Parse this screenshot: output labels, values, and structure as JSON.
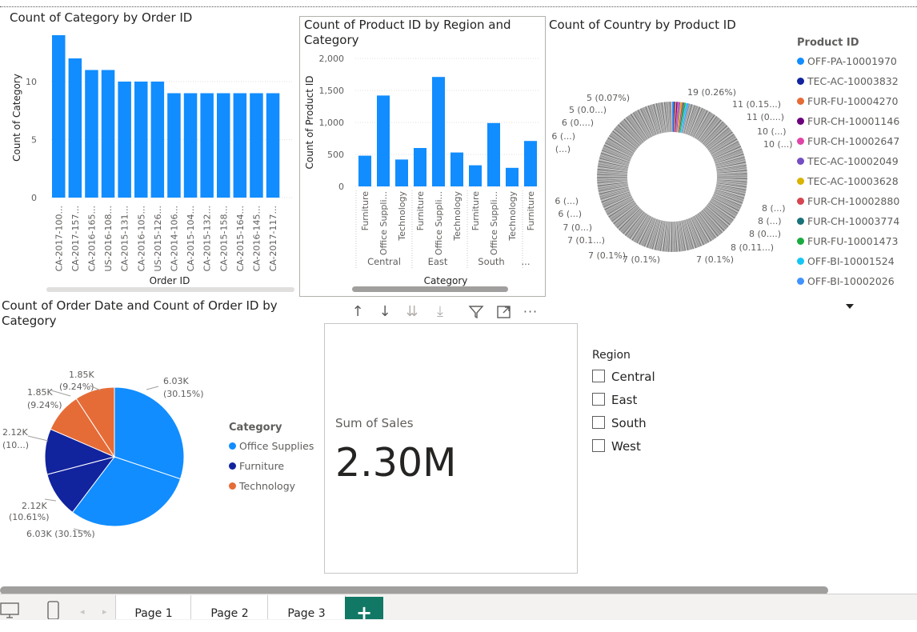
{
  "colors": {
    "accent": "#118dff",
    "navy": "#12239e",
    "orange": "#e66c37",
    "add_tab": "#117865"
  },
  "chart1": {
    "title": "Count of Category by Order ID",
    "chart_data": {
      "type": "bar",
      "title": "Count of Category by Order ID",
      "xlabel": "Order ID",
      "ylabel": "Count of Category",
      "ylim": [
        0,
        14
      ],
      "yticks": [
        "0",
        "5",
        "10"
      ],
      "categories": [
        "CA-2017-100...",
        "CA-2017-157...",
        "CA-2016-165...",
        "US-2016-108...",
        "CA-2015-131...",
        "CA-2016-105...",
        "US-2015-126...",
        "CA-2014-106...",
        "CA-2015-104...",
        "CA-2015-132...",
        "CA-2015-158...",
        "CA-2015-164...",
        "CA-2016-145...",
        "CA-2017-117..."
      ],
      "values": [
        14,
        12,
        11,
        11,
        10,
        10,
        10,
        9,
        9,
        9,
        9,
        9,
        9,
        9
      ]
    }
  },
  "chart2": {
    "title_line1": "Count of Product ID by Region and",
    "title_line2": "Category",
    "chart_data": {
      "type": "bar",
      "title": "Count of Product ID by Region and Category",
      "xlabel": "Category",
      "ylabel": "Count of Product ID",
      "ylim": [
        0,
        2000
      ],
      "yticks": [
        "0",
        "500",
        "1,000",
        "1,500",
        "2,000"
      ],
      "categories": [
        "Furniture",
        "Office Suppli...",
        "Technology",
        "Furniture",
        "Office Suppli...",
        "Technology",
        "Furniture",
        "Office Suppli...",
        "Technology",
        "Furniture"
      ],
      "groups": [
        "Central",
        "East",
        "South",
        "..."
      ],
      "values": [
        480,
        1420,
        420,
        600,
        1710,
        530,
        330,
        990,
        290,
        710
      ]
    }
  },
  "chart3": {
    "title": "Count of Country by Product ID",
    "legend_title": "Product ID",
    "legend": [
      {
        "label": "OFF-PA-10001970",
        "color": "#118dff"
      },
      {
        "label": "TEC-AC-10003832",
        "color": "#12239e"
      },
      {
        "label": "FUR-FU-10004270",
        "color": "#e66c37"
      },
      {
        "label": "FUR-CH-10001146",
        "color": "#6b007b"
      },
      {
        "label": "FUR-CH-10002647",
        "color": "#e044a7"
      },
      {
        "label": "TEC-AC-10002049",
        "color": "#744ec2"
      },
      {
        "label": "TEC-AC-10003628",
        "color": "#d9b300"
      },
      {
        "label": "FUR-CH-10002880",
        "color": "#d64550"
      },
      {
        "label": "FUR-CH-10003774",
        "color": "#197278"
      },
      {
        "label": "FUR-FU-10001473",
        "color": "#1aab40"
      },
      {
        "label": "OFF-BI-10001524",
        "color": "#15c6f4"
      },
      {
        "label": "OFF-BI-10002026",
        "color": "#4092ff"
      }
    ],
    "labels": [
      "19 (0.26%)",
      "11 (0.15...)",
      "11 (0....)",
      "10 (...)",
      "10 (...)",
      "8 (...)",
      "8 (...)",
      "8 (0....)",
      "8 (0.11...)",
      "7 (0.1%)",
      "7 (0.1%)",
      "7 (0.1%)",
      "7 (0.1...)",
      "7 (0...)",
      "6 (...)",
      "6 (...)",
      "6 (...)",
      "6 (...)",
      "6 (0....)",
      "5 (0.0...)",
      "5 (0.07%)"
    ]
  },
  "chart4": {
    "title_line1": "Count of Order Date and Count of Order ID by",
    "title_line2": "Category",
    "legend_title": "Category",
    "legend": [
      {
        "label": "Office Supplies",
        "color": "#118dff"
      },
      {
        "label": "Furniture",
        "color": "#12239e"
      },
      {
        "label": "Technology",
        "color": "#e66c37"
      }
    ],
    "chart_data": {
      "type": "pie",
      "title": "Count of Order Date and Count of Order ID by Category",
      "slices": [
        {
          "name": "Office Supplies",
          "value": 6030,
          "label": "6.03K",
          "pct": "(30.15%)",
          "color": "#118dff"
        },
        {
          "name": "Office Supplies",
          "value": 6030,
          "label": "6.03K (30.15%)",
          "color": "#118dff"
        },
        {
          "name": "Furniture",
          "value": 2120,
          "label": "2.12K",
          "pct": "(10.61%)",
          "color": "#12239e"
        },
        {
          "name": "Furniture",
          "value": 2120,
          "label": "2.12K",
          "pct": "(10...)",
          "color": "#12239e"
        },
        {
          "name": "Technology",
          "value": 1850,
          "label": "1.85K",
          "pct": "(9.24%)",
          "color": "#e66c37"
        },
        {
          "name": "Technology",
          "value": 1850,
          "label": "1.85K",
          "pct": "(9.24%)",
          "color": "#e66c37"
        }
      ]
    }
  },
  "card": {
    "label": "Sum of Sales",
    "value": "2.30M"
  },
  "slicer": {
    "title": "Region",
    "items": [
      "Central",
      "East",
      "South",
      "West"
    ]
  },
  "tabs": {
    "page1": "Page 1",
    "page2": "Page 2",
    "page3": "Page 3",
    "add": "+"
  }
}
